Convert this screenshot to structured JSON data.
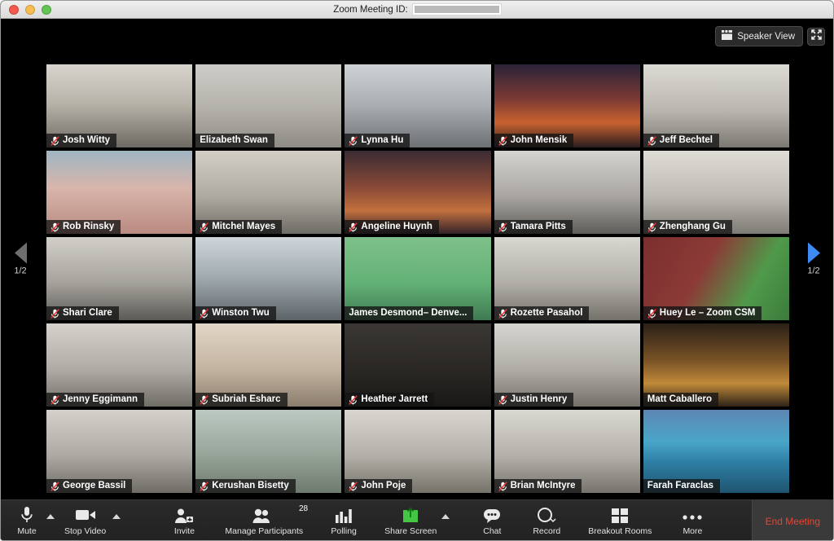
{
  "window": {
    "title_label": "Zoom Meeting ID:",
    "meeting_id_redacted": true,
    "traffic_lights": [
      "close-button",
      "minimize-button",
      "maximize-button"
    ]
  },
  "stage": {
    "view_toggle": {
      "label": "Speaker View",
      "icon": "gallery-grid-icon"
    },
    "fullscreen": {
      "icon": "fullscreen-icon"
    },
    "pager_left": {
      "label": "1/2",
      "icon": "chevron-left-icon",
      "color": "#6e6e6e"
    },
    "pager_right": {
      "label": "1/2",
      "icon": "chevron-right-icon",
      "color": "#3d8bf2"
    }
  },
  "participants": [
    {
      "name": "Josh Witty",
      "muted": true,
      "active": false,
      "bg": "office-a"
    },
    {
      "name": "Elizabeth Swan",
      "muted": false,
      "active": false,
      "bg": "cubicle-green"
    },
    {
      "name": "Lynna Hu",
      "muted": true,
      "active": false,
      "bg": "office-b"
    },
    {
      "name": "John Mensik",
      "muted": true,
      "active": false,
      "bg": "sunset-virtual"
    },
    {
      "name": "Jeff Bechtel",
      "muted": true,
      "active": false,
      "bg": "office-c"
    },
    {
      "name": "Rob Rinsky",
      "muted": true,
      "active": false,
      "bg": "baby-closeup"
    },
    {
      "name": "Mitchel Mayes",
      "muted": true,
      "active": false,
      "bg": "office-d"
    },
    {
      "name": "Angeline Huynh",
      "muted": true,
      "active": false,
      "bg": "desert-virtual"
    },
    {
      "name": "Tamara Pitts",
      "muted": true,
      "active": false,
      "bg": "office-e"
    },
    {
      "name": "Zhenghang Gu",
      "muted": true,
      "active": false,
      "bg": "office-f"
    },
    {
      "name": "Shari Clare",
      "muted": true,
      "active": false,
      "bg": "office-g"
    },
    {
      "name": "Winston Twu",
      "muted": true,
      "active": false,
      "bg": "train-virtual"
    },
    {
      "name": "James Desmond– Denve...",
      "muted": false,
      "active": false,
      "bg": "greenscreen"
    },
    {
      "name": "Rozette Pasahol",
      "muted": true,
      "active": false,
      "bg": "office-h"
    },
    {
      "name": "Huey Le – Zoom CSM",
      "muted": true,
      "active": false,
      "bg": "green-wall"
    },
    {
      "name": "Jenny Eggimann",
      "muted": true,
      "active": false,
      "bg": "office-i"
    },
    {
      "name": "Subriah Esharc",
      "muted": true,
      "active": false,
      "bg": "home-warm"
    },
    {
      "name": "Heather Jarrett",
      "muted": true,
      "active": false,
      "bg": "dark-room"
    },
    {
      "name": "Justin Henry",
      "muted": true,
      "active": false,
      "bg": "office-j"
    },
    {
      "name": "Matt Caballero",
      "muted": false,
      "active": false,
      "bg": "forest-virtual"
    },
    {
      "name": "George Bassil",
      "muted": true,
      "active": false,
      "bg": "office-k"
    },
    {
      "name": "Kerushan Bisetty",
      "muted": true,
      "active": false,
      "bg": "backyard"
    },
    {
      "name": "John Poje",
      "muted": true,
      "active": false,
      "bg": "office-l"
    },
    {
      "name": "Brian McIntyre",
      "muted": true,
      "active": false,
      "bg": "office-m"
    },
    {
      "name": "Farah Faraclas",
      "muted": false,
      "active": true,
      "bg": "lake-virtual"
    }
  ],
  "toolbar": {
    "mute": {
      "label": "Mute",
      "icon": "microphone-icon",
      "has_caret": true
    },
    "stop_video": {
      "label": "Stop Video",
      "icon": "video-camera-icon",
      "has_caret": true
    },
    "invite": {
      "label": "Invite",
      "icon": "person-plus-icon"
    },
    "manage_participants": {
      "label": "Manage Participants",
      "icon": "people-icon",
      "badge": "28"
    },
    "polling": {
      "label": "Polling",
      "icon": "bar-chart-icon"
    },
    "share_screen": {
      "label": "Share Screen",
      "icon": "share-screen-icon",
      "has_caret": true,
      "color": "#44c544"
    },
    "chat": {
      "label": "Chat",
      "icon": "chat-bubble-icon"
    },
    "record": {
      "label": "Record",
      "icon": "record-circle-icon"
    },
    "breakout_rooms": {
      "label": "Breakout Rooms",
      "icon": "grid-squares-icon"
    },
    "more": {
      "label": "More",
      "icon": "ellipsis-icon"
    },
    "end_meeting": {
      "label": "End Meeting",
      "color": "#e8442e"
    }
  }
}
